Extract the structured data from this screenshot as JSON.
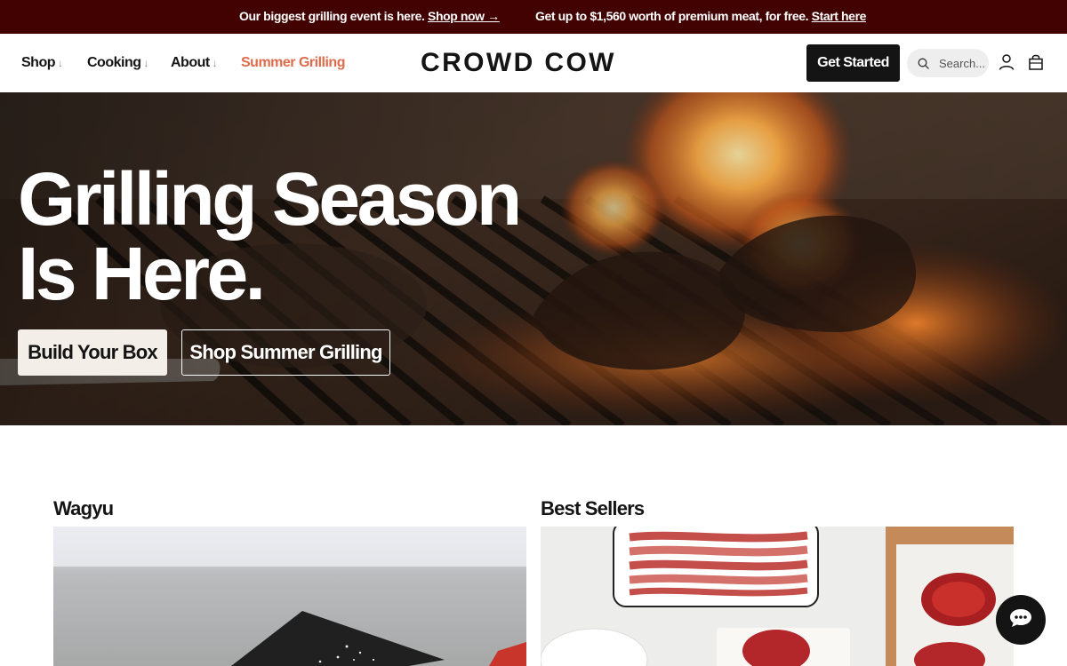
{
  "announcement": {
    "promo1_text": "Our biggest grilling event is here.",
    "promo1_link": "Shop now →",
    "promo2_text": "Get up to $1,560 worth of premium meat, for free.",
    "promo2_link": "Start here"
  },
  "header": {
    "nav": [
      {
        "label": "Shop",
        "has_dropdown": true
      },
      {
        "label": "Cooking",
        "has_dropdown": true
      },
      {
        "label": "About",
        "has_dropdown": true
      },
      {
        "label": "Summer Grilling",
        "has_dropdown": false
      }
    ],
    "dropdown_arrow": "↓",
    "logo": "CROWD COW",
    "cta_label": "Get Started",
    "search_placeholder": "Search...",
    "icons": [
      "search-icon",
      "account-icon",
      "shopping-bag-icon"
    ]
  },
  "hero": {
    "title": "Grilling Season Is Here.",
    "primary_button": "Build Your Box",
    "secondary_button": "Shop Summer Grilling"
  },
  "categories": [
    {
      "label": "Wagyu"
    },
    {
      "label": "Best Sellers"
    }
  ],
  "chat": {
    "icon": "chat-bubble-icon"
  },
  "colors": {
    "announcement_bg": "#420202",
    "accent_orange": "#e06b4b",
    "dark": "#141414",
    "cream_button": "#f3efe8"
  }
}
